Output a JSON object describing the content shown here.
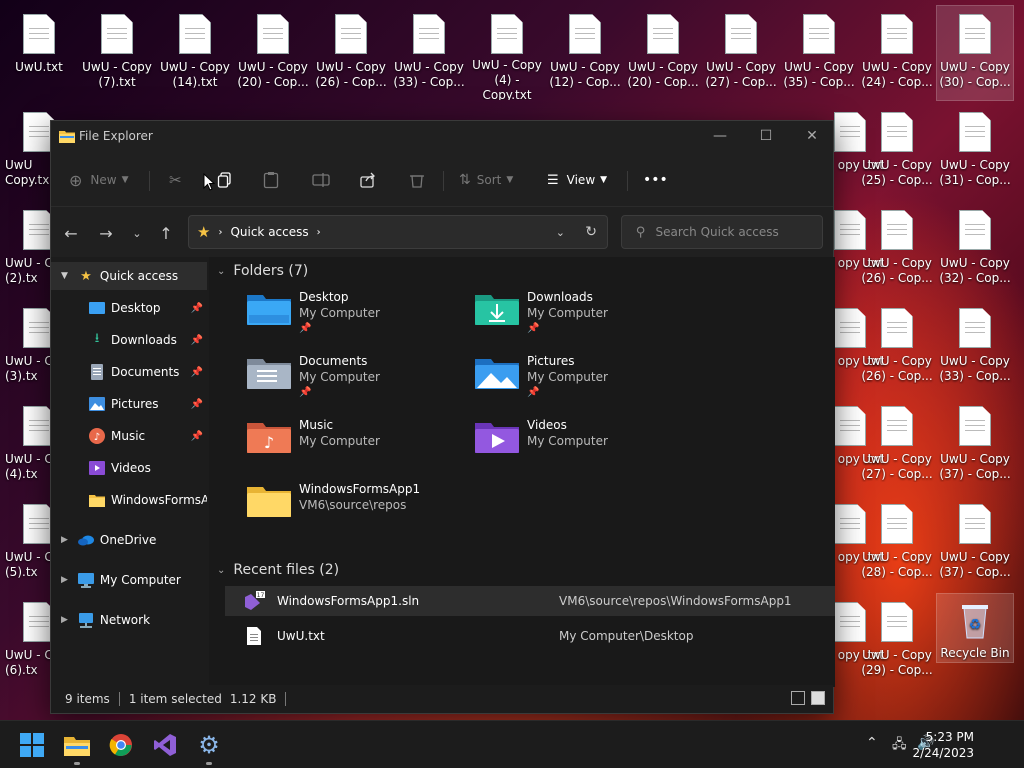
{
  "desktop": {
    "icons_row1": [
      "UwU.txt",
      "UwU - Copy (7).txt",
      "UwU - Copy (14).txt",
      "UwU - Copy (20) - Cop...",
      "UwU - Copy (26) - Cop...",
      "UwU - Copy (33) - Cop...",
      "UwU - Copy (4) - Copy.txt",
      "UwU - Copy (12) - Cop...",
      "UwU - Copy (20) - Cop...",
      "UwU - Copy (27) - Cop...",
      "UwU - Copy (35) - Cop...",
      "UwU - Copy (24) - Cop...",
      "UwU - Copy (30) - Cop..."
    ],
    "left_column": [
      "UwU Copy.tx",
      "UwU - C (2).tx",
      "UwU - C (3).tx",
      "UwU - C (4).tx",
      "UwU - C (5).tx",
      "UwU - C (6).tx"
    ],
    "right_partial": [
      "opy .txt",
      "opy .txt",
      "opy .txt",
      "opy .txt",
      "opy .txt",
      "opy .txt"
    ],
    "col_a": [
      "UwU - Copy (25) - Cop...",
      "UwU - Copy (26) - Cop...",
      "UwU - Copy (26) - Cop...",
      "UwU - Copy (27) - Cop...",
      "UwU - Copy (28) - Cop...",
      "UwU - Copy (29) - Cop..."
    ],
    "col_b": [
      "UwU - Copy (31) - Cop...",
      "UwU - Copy (32) - Cop...",
      "UwU - Copy (33) - Cop...",
      "UwU - Copy (37) - Cop...",
      "UwU - Copy (37) - Cop..."
    ],
    "recycle_bin": "Recycle Bin"
  },
  "explorer": {
    "title": "File Explorer",
    "toolbar": {
      "new_label": "New",
      "sort_label": "Sort",
      "view_label": "View",
      "more_label": "•••"
    },
    "address": {
      "location": "Quick access"
    },
    "search": {
      "placeholder": "Search Quick access"
    },
    "sidebar": {
      "quick_access": "Quick access",
      "items": [
        {
          "label": "Desktop"
        },
        {
          "label": "Downloads"
        },
        {
          "label": "Documents"
        },
        {
          "label": "Pictures"
        },
        {
          "label": "Music"
        },
        {
          "label": "Videos"
        },
        {
          "label": "WindowsFormsApp"
        }
      ],
      "onedrive": "OneDrive",
      "my_computer": "My Computer",
      "network": "Network"
    },
    "folders_header": "Folders (7)",
    "folders": [
      {
        "name": "Desktop",
        "location": "My Computer"
      },
      {
        "name": "Downloads",
        "location": "My Computer"
      },
      {
        "name": "Documents",
        "location": "My Computer"
      },
      {
        "name": "Pictures",
        "location": "My Computer"
      },
      {
        "name": "Music",
        "location": "My Computer"
      },
      {
        "name": "Videos",
        "location": "My Computer"
      },
      {
        "name": "WindowsFormsApp1",
        "location": "VM6\\source\\repos"
      }
    ],
    "recent_header": "Recent files (2)",
    "recent": [
      {
        "name": "WindowsFormsApp1.sln",
        "path": "VM6\\source\\repos\\WindowsFormsApp1"
      },
      {
        "name": "UwU.txt",
        "path": "My Computer\\Desktop"
      }
    ],
    "status": {
      "items": "9 items",
      "selected": "1 item selected",
      "size": "1.12 KB"
    }
  },
  "taskbar": {
    "time": "5:23 PM",
    "date": "2/24/2023"
  },
  "colors": {
    "accent": "#0078d4",
    "folder_yellow": "#f5c244",
    "window_bg": "#1c1c1c"
  }
}
